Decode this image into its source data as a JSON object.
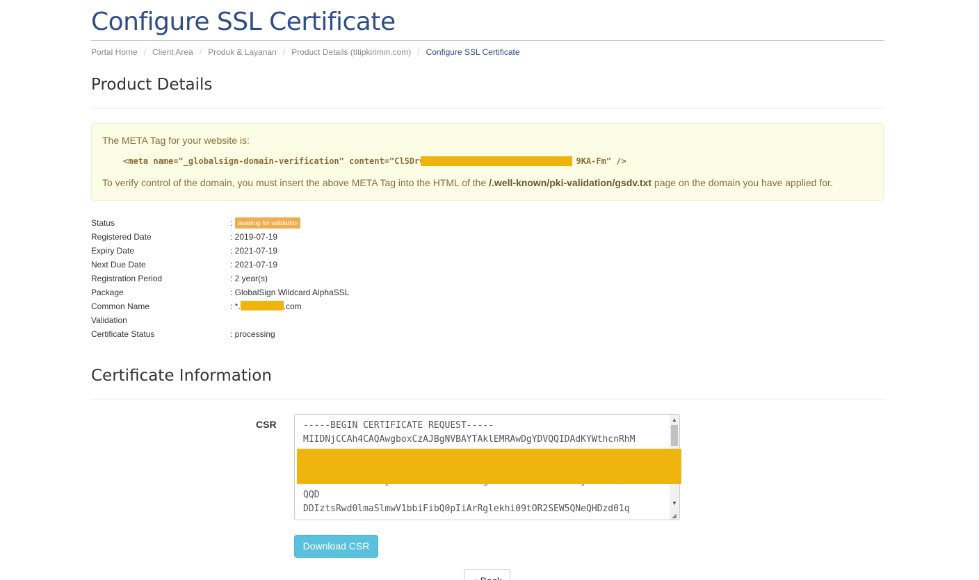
{
  "page": {
    "title": "Configure SSL Certificate"
  },
  "breadcrumb": [
    {
      "label": "Portal Home"
    },
    {
      "label": "Client Area"
    },
    {
      "label": "Produk & Layanan"
    },
    {
      "label": "Product Details (titipkirimin.com)"
    },
    {
      "label": "Configure SSL Certificate"
    }
  ],
  "product_details": {
    "heading": "Product Details",
    "alert": {
      "intro": "The META Tag for your website is:",
      "meta_prefix": "<meta name=\"_globalsign-domain-verification\" content=\"Cl5DrC",
      "meta_suffix": "9KA-Fm\" />",
      "instruction_before": "To verify control of the domain, you must insert the above META Tag into the HTML of the ",
      "path": "/.well-known/pki-validation/gsdv.txt",
      "instruction_after": " page on the domain you have applied for."
    },
    "fields": {
      "status": {
        "label": "Status",
        "value": "awaiting for validation"
      },
      "registered_date": {
        "label": "Registered Date",
        "value": ": 2019-07-19"
      },
      "expiry_date": {
        "label": "Expiry Date",
        "value": ": 2021-07-19"
      },
      "next_due_date": {
        "label": "Next Due Date",
        "value": ": 2021-07-19"
      },
      "registration_period": {
        "label": "Registration Period",
        "value": ": 2 year(s)"
      },
      "package": {
        "label": "Package",
        "value": ": GlobalSign Wildcard AlphaSSL"
      },
      "common_name": {
        "label": "Common Name",
        "prefix": ": *.",
        "suffix": ".com"
      },
      "validation": {
        "label": "Validation"
      },
      "certificate_status": {
        "label": "Certificate Status",
        "value": ": processing"
      }
    }
  },
  "certificate_information": {
    "heading": "Certificate Information",
    "csr_label": "CSR",
    "csr_text": "-----BEGIN CERTIFICATE REQUEST-----\nMIIDNjCCAh4CAQAwgboxCzAJBgNVBAYTAklEMRAwDgYDVQQIDAdKYWthcnRhM\n\n\nR2xvYmFsIEludGVybmFzaW9uYWwxETAPBgNVBAsMCExvZ2lzdGljMRswGQYDV\nQQD\nDDIztsRwd0lmaSlmwV1bbiFibQ0pIiArRglekhi09tOR2SEW5QNeQHDzd01q",
    "download_label": "Download CSR",
    "back_label": "« Back"
  },
  "colors": {
    "title": "#2f4d86",
    "alert_bg": "#fbfde4",
    "alert_text": "#8a6d3b",
    "badge": "#f0ad4e",
    "download_button": "#5bc0de",
    "redaction": "#f0b40f"
  },
  "icons": {
    "scroll_up": "scroll-up-arrow-icon",
    "scroll_down": "scroll-down-arrow-icon",
    "resize": "resize-handle-icon"
  }
}
